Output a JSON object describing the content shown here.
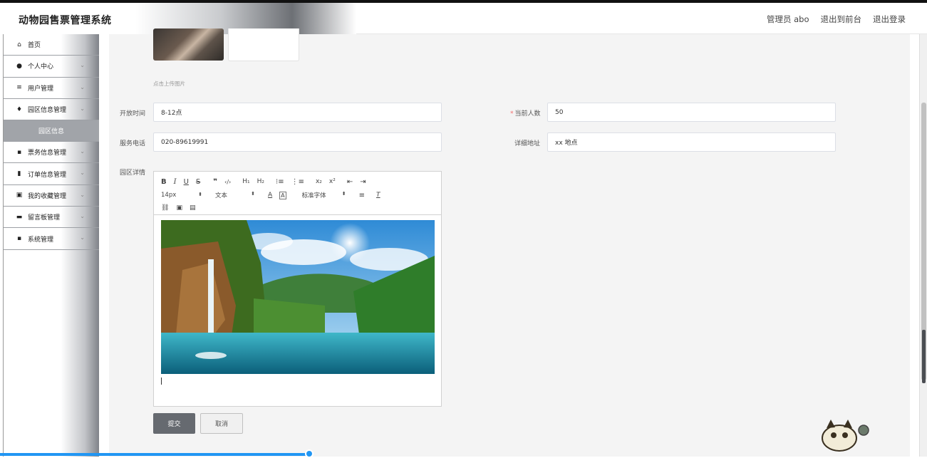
{
  "header": {
    "title": "动物园售票管理系统",
    "user_label": "管理员 abo",
    "to_front": "退出到前台",
    "logout": "退出登录"
  },
  "sidebar": {
    "items": [
      {
        "label": "首页",
        "icon": "home-icon",
        "glyph": "⌂"
      },
      {
        "label": "个人中心",
        "icon": "user-icon",
        "glyph": "●"
      },
      {
        "label": "用户管理",
        "icon": "menu-icon",
        "glyph": "≡"
      },
      {
        "label": "园区信息管理",
        "icon": "pin-icon",
        "glyph": "♦"
      },
      {
        "label": "园区信息"
      },
      {
        "label": "票务信息管理",
        "icon": "grid-icon",
        "glyph": "▪"
      },
      {
        "label": "订单信息管理",
        "icon": "bar-chart-icon",
        "glyph": "▮"
      },
      {
        "label": "我的收藏管理",
        "icon": "clipboard-icon",
        "glyph": "▣"
      },
      {
        "label": "留言板管理",
        "icon": "monitor-icon",
        "glyph": "▬"
      },
      {
        "label": "系统管理",
        "icon": "grid-icon",
        "glyph": "▪"
      }
    ],
    "chevron": "⌄"
  },
  "form": {
    "upload_hint": "点击上传图片",
    "open_time_label": "开放时间",
    "open_time_value": "8-12点",
    "current_count_label": "当前人数",
    "current_count_value": "50",
    "required_mark": "*",
    "phone_label": "服务电话",
    "phone_value": "020-89619991",
    "address_label": "详细地址",
    "address_value": "xx 地点",
    "detail_label": "园区详情"
  },
  "editor": {
    "font_size": "14px",
    "text_type": "文本",
    "font_family": "标准字体",
    "select_arrow": "⬍"
  },
  "buttons": {
    "submit": "提交",
    "cancel": "取消"
  }
}
